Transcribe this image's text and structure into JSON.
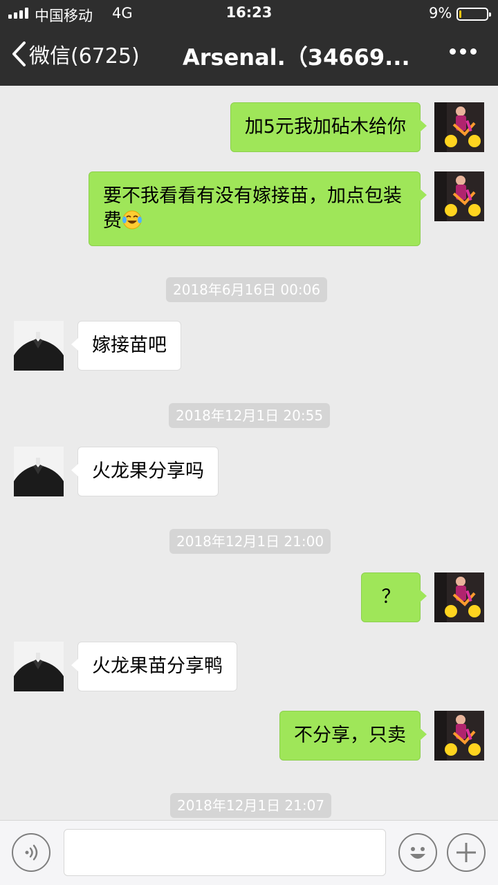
{
  "status_bar": {
    "carrier": "中国移动",
    "network": "4G",
    "time": "16:23",
    "battery_percent": "9%",
    "battery_level": 0.09,
    "battery_color": "#f1c40f"
  },
  "nav": {
    "back_label": "微信(6725)",
    "title": "Arsenal.（34669...",
    "more_icon": "more-dots-icon"
  },
  "messages": [
    {
      "type": "msg",
      "from": "me",
      "text": "加5元我加砧木给你"
    },
    {
      "type": "msg",
      "from": "me",
      "text": "要不我看看有没有嫁接苗，加点包装费",
      "emoji": "laughing-crying-emoji"
    },
    {
      "type": "time",
      "text": "2018年6月16日 00:06"
    },
    {
      "type": "msg",
      "from": "friend",
      "text": "嫁接苗吧"
    },
    {
      "type": "time",
      "text": "2018年12月1日 20:55"
    },
    {
      "type": "msg",
      "from": "friend",
      "text": "火龙果分享吗"
    },
    {
      "type": "time",
      "text": "2018年12月1日 21:00"
    },
    {
      "type": "msg",
      "from": "me",
      "text": "？"
    },
    {
      "type": "msg",
      "from": "friend",
      "text": "火龙果苗分享鸭"
    },
    {
      "type": "msg",
      "from": "me",
      "text": "不分享，只卖"
    },
    {
      "type": "time",
      "text": "2018年12月1日 21:07"
    }
  ],
  "input_bar": {
    "voice_icon": "voice-icon",
    "emoji_icon": "emoji-icon",
    "plus_icon": "plus-icon",
    "input_value": ""
  },
  "colors": {
    "nav_bg": "#2e2e2e",
    "chat_bg": "#ebebeb",
    "my_bubble": "#9fe659",
    "friend_bubble": "#ffffff",
    "timestamp_bg": "#d5d5d5"
  }
}
